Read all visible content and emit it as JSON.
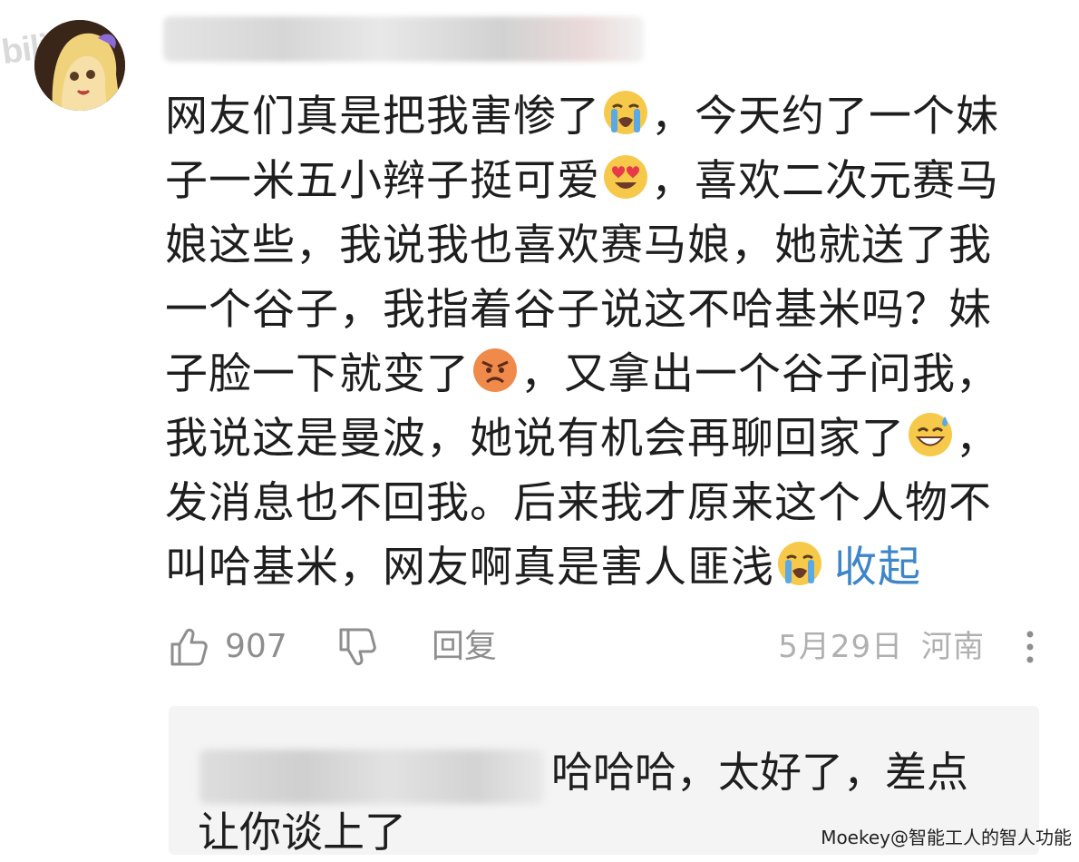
{
  "watermark_logo": "bili",
  "comment": {
    "username": "",
    "lines": [
      {
        "parts": [
          {
            "t": "网友们真是把我害惨了"
          },
          {
            "emoji": "loudly-crying-face"
          },
          {
            "t": "，今天约了一个妹"
          }
        ]
      },
      {
        "parts": [
          {
            "t": "子一米五小辫子挺可爱"
          },
          {
            "emoji": "heart-eyes-face"
          },
          {
            "t": "，喜欢二次元赛马"
          }
        ]
      },
      {
        "parts": [
          {
            "t": "娘这些，我说我也喜欢赛马娘，她就送了我"
          }
        ]
      },
      {
        "parts": [
          {
            "t": "一个谷子，我指着谷子说这不哈基米吗？妹"
          }
        ]
      },
      {
        "parts": [
          {
            "t": "子脸一下就变了"
          },
          {
            "emoji": "angry-face"
          },
          {
            "t": "，又拿出一个谷子问我，"
          }
        ]
      },
      {
        "parts": [
          {
            "t": "我说这是曼波，她说有机会再聊回家了"
          },
          {
            "emoji": "grinning-sweat-face"
          },
          {
            "t": "，"
          }
        ]
      },
      {
        "parts": [
          {
            "t": "发消息也不回我。后来我才原来这个人物不"
          }
        ]
      },
      {
        "parts": [
          {
            "t": "叫哈基米，网友啊真是害人匪浅"
          },
          {
            "emoji": "loudly-crying-face"
          }
        ]
      }
    ],
    "collapse_label": "收起",
    "like_count": "907",
    "reply_label": "回复",
    "date": "5月29日",
    "location": "河南",
    "icons": {
      "like": "thumbs-up-icon",
      "dislike": "thumbs-down-icon",
      "more": "more-vertical-icon"
    }
  },
  "reply": {
    "username": "",
    "text_line1": "哈哈哈，太好了，差点",
    "text_line2": "让你谈上了"
  },
  "footer_watermark": "Moekey@智能工人的智人功能",
  "colors": {
    "link": "#3e86c9",
    "meta": "#b0b0b0",
    "reply_bg": "#f4f4f5"
  }
}
